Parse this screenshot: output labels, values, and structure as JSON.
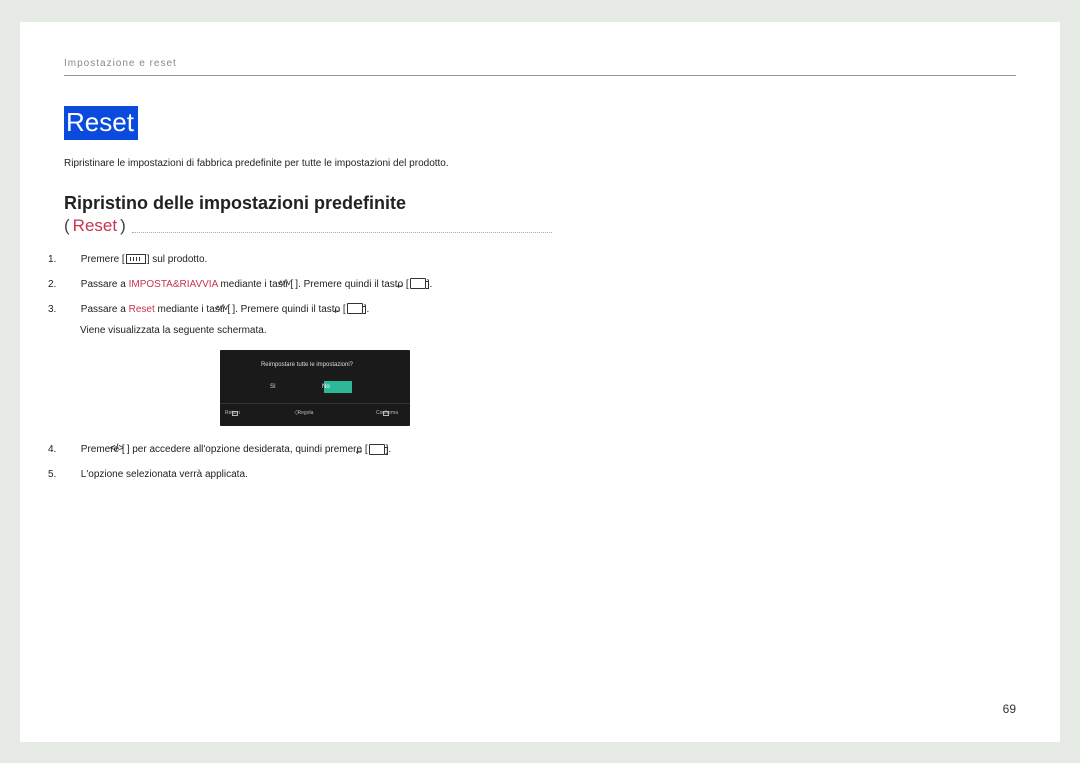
{
  "header": "Impostazione e reset",
  "titleBadge": "Reset",
  "intro": "Ripristinare le impostazioni di fabbrica predefinite per tutte le impostazioni del prodotto.",
  "sectionTitle": "Ripristino delle impostazioni predefinite",
  "subtitleRed": "Reset",
  "steps": {
    "s1_a": "Premere [",
    "s1_b": "] sul prodotto.",
    "s2_a": "Passare a ",
    "s2_kw": "IMPOSTA&RIAVVIA",
    "s2_b": " mediante i tasti [",
    "s2_c": "]. Premere quindi il tasto [",
    "s2_d": "].",
    "s3_a": "Passare a ",
    "s3_kw": "Reset",
    "s3_b": " mediante i tasti [",
    "s3_c": "]. Premere quindi il tasto [",
    "s3_d": "].",
    "s3_desc": "Viene visualizzata la seguente schermata.",
    "s4_a": "Premere [",
    "s4_b": "] per accedere all'opzione desiderata, quindi premere [",
    "s4_c": "].",
    "s5": "L'opzione selezionata verrà applicata."
  },
  "screenshot": {
    "question": "Reimpostare tutte le impostazioni?",
    "optYes": "Sì",
    "optNo": "No",
    "footerReturn": "Return",
    "footerRegola": "Regola",
    "footerConferma": "Conferma"
  },
  "pageNumber": "69"
}
